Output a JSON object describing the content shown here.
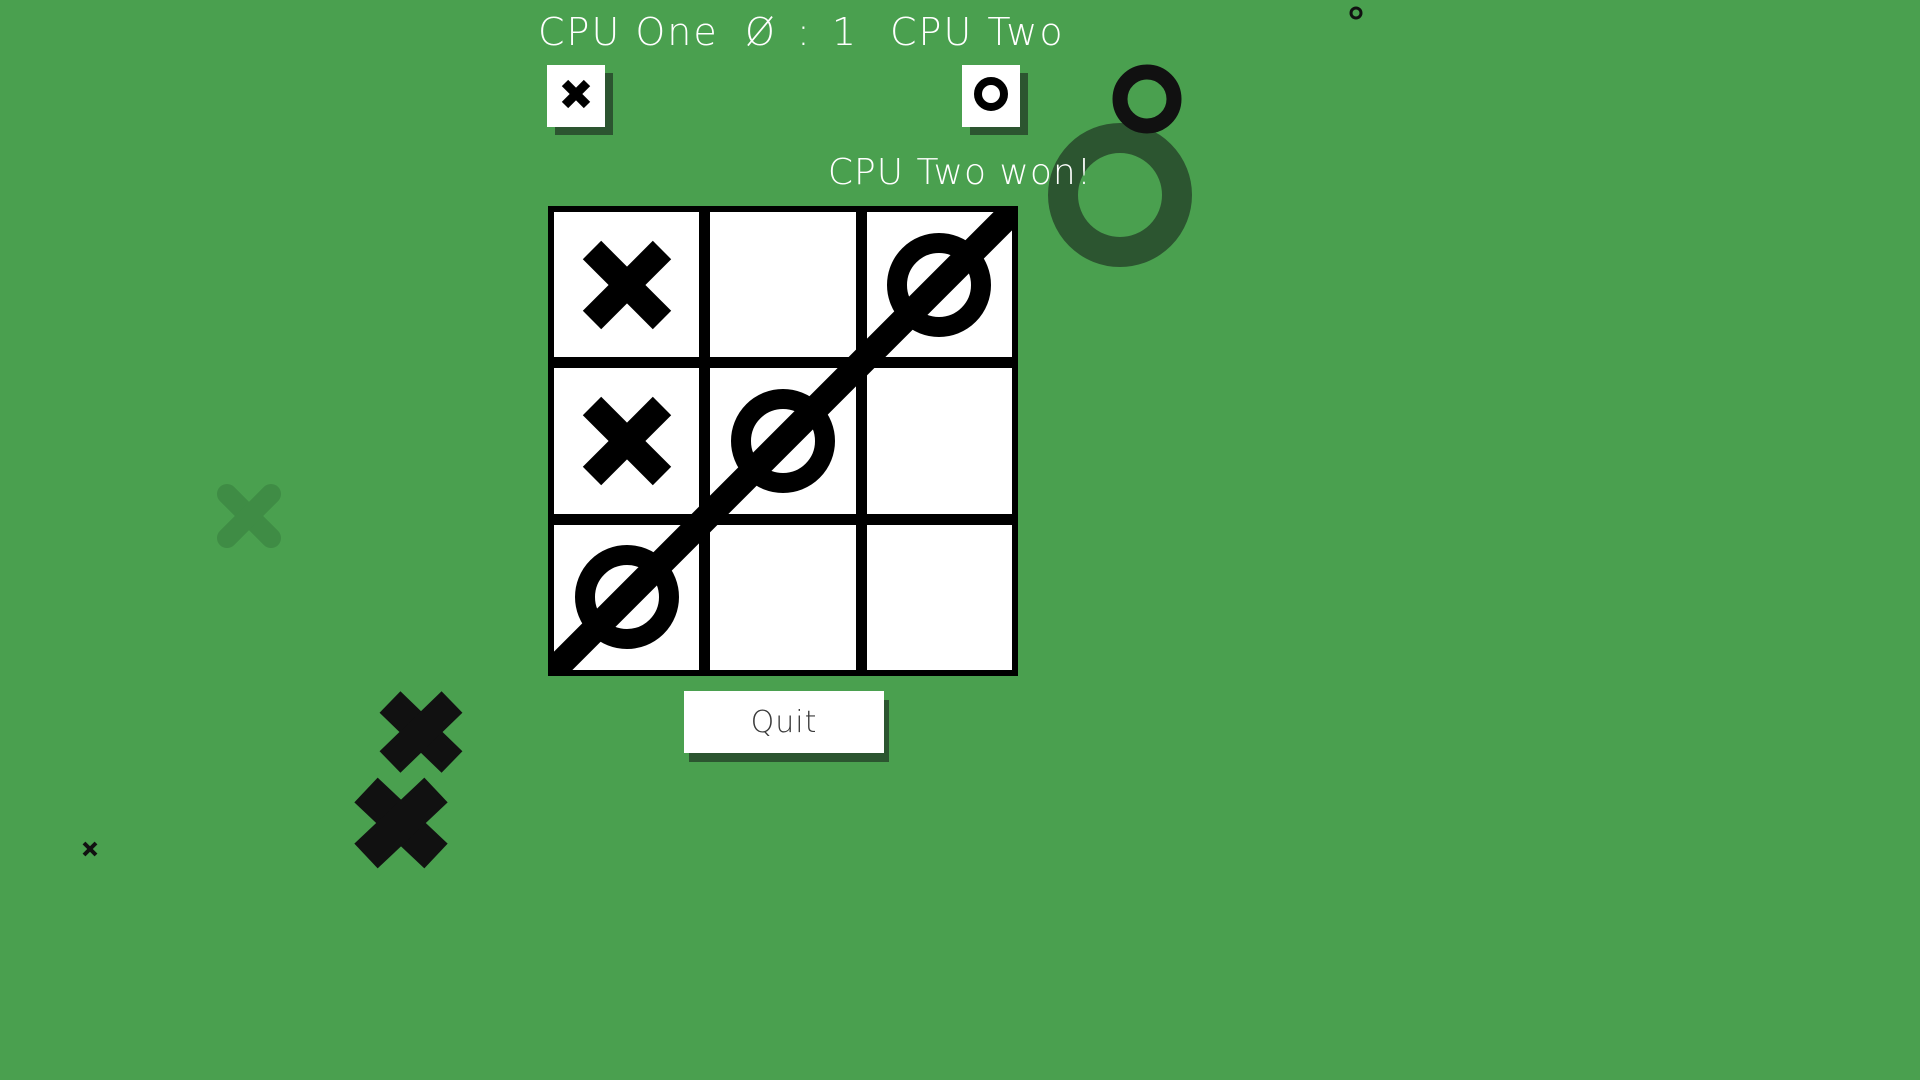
{
  "theme": {
    "background_color": "#4aa04f",
    "mark_color": "#000000",
    "cell_color": "#ffffff",
    "text_color": "#ffffff",
    "shadow_color": "#2c5530",
    "deco_x_color": "#3f8c45",
    "deco_o_color": "#2c5530"
  },
  "header": {
    "player_one_label": "CPU One",
    "score": "Ø : 1",
    "player_two_label": "CPU Two",
    "player_one_symbol": "X",
    "player_two_symbol": "O"
  },
  "status": {
    "message": "CPU Two won!"
  },
  "board": {
    "cells": [
      {
        "index": 0,
        "mark": "X"
      },
      {
        "index": 1,
        "mark": ""
      },
      {
        "index": 2,
        "mark": "O"
      },
      {
        "index": 3,
        "mark": "X"
      },
      {
        "index": 4,
        "mark": "O"
      },
      {
        "index": 5,
        "mark": ""
      },
      {
        "index": 6,
        "mark": "O"
      },
      {
        "index": 7,
        "mark": ""
      },
      {
        "index": 8,
        "mark": ""
      }
    ],
    "win_line": "anti-diagonal"
  },
  "controls": {
    "quit_label": "Quit"
  },
  "decorations": [
    {
      "name": "deco-o-large",
      "type": "O"
    },
    {
      "name": "deco-o-small",
      "type": "O"
    },
    {
      "name": "deco-o-tiny",
      "type": "O"
    },
    {
      "name": "deco-x-faded",
      "type": "X"
    },
    {
      "name": "deco-x-large",
      "type": "X"
    },
    {
      "name": "deco-x-mid",
      "type": "X"
    },
    {
      "name": "deco-x-tiny",
      "type": "X"
    }
  ]
}
